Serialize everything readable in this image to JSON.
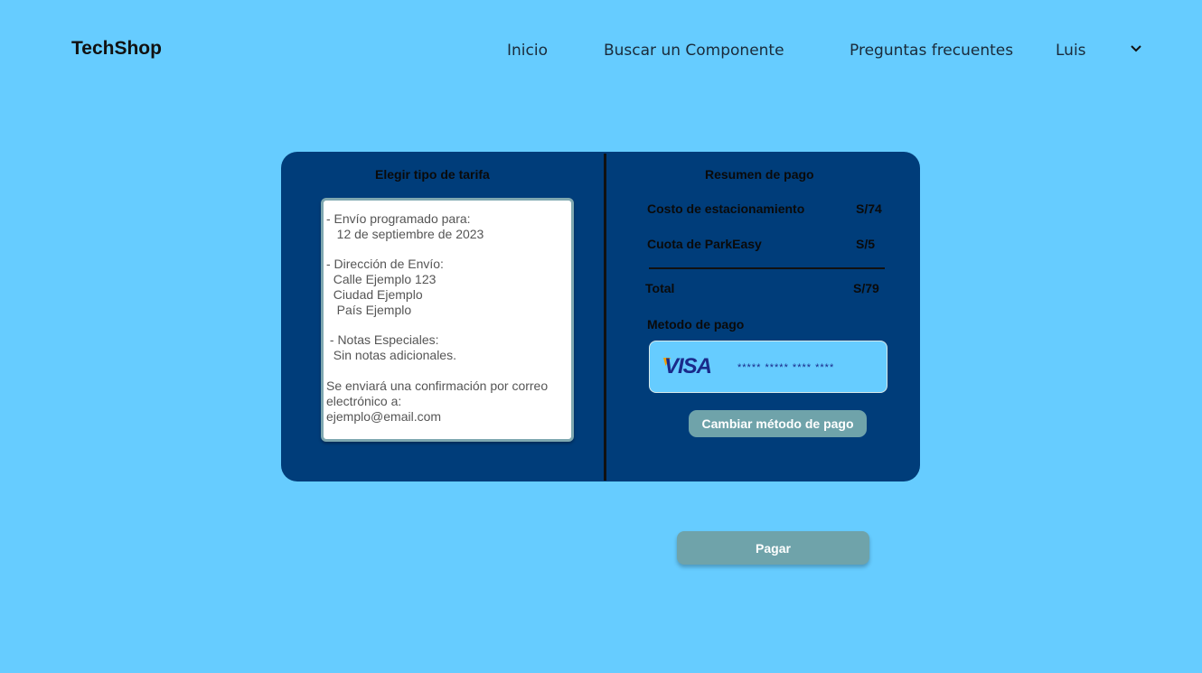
{
  "header": {
    "brand": "TechShop",
    "nav": [
      "Inicio",
      "Buscar un Componente",
      "Preguntas frecuentes"
    ],
    "user": "Luis",
    "user_icon": "chevron-down-icon"
  },
  "left": {
    "title": "Elegir tipo de tarifa",
    "lines": [
      "- Envío programado para:",
      "   12 de septiembre de 2023",
      "- Dirección de Envío:",
      "  Calle Ejemplo 123",
      "  Ciudad Ejemplo",
      "   País Ejemplo",
      " - Notas Especiales:",
      "  Sin notas adicionales.",
      "Se enviará una confirmación por correo",
      "electrónico a:",
      "ejemplo@email.com"
    ]
  },
  "summary": {
    "title": "Resumen de pago",
    "rows": [
      {
        "label": "Costo de estacionamiento",
        "value": "S/74"
      },
      {
        "label": "Cuota de ParkEasy",
        "value": "S/5"
      }
    ],
    "total_label": "Total",
    "total_value": "S/79",
    "payment_method_label": "Metodo de pago",
    "card_brand": "VISA",
    "card_number": "***** ***** **** ****",
    "change_button": "Cambiar método de pago"
  },
  "pay_button": "Pagar",
  "colors": {
    "background": "#66ccff",
    "panel": "#003d7a",
    "button": "#6fa3aa"
  }
}
